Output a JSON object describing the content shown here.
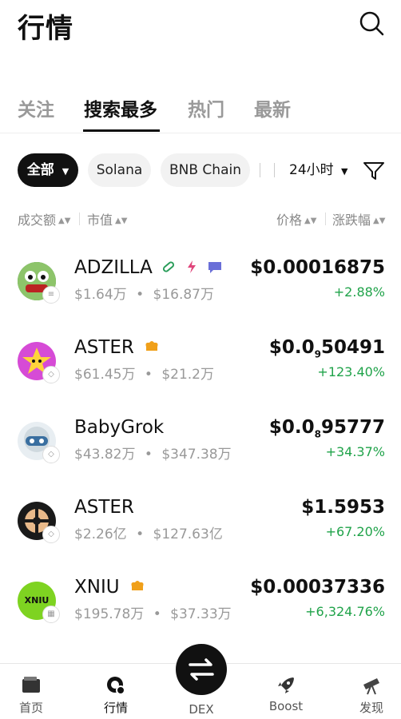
{
  "header": {
    "title": "行情"
  },
  "tabs": [
    {
      "label": "关注"
    },
    {
      "label": "搜索最多"
    },
    {
      "label": "热门"
    },
    {
      "label": "最新"
    }
  ],
  "filters": {
    "chips": [
      "全部",
      "Solana",
      "BNB Chain"
    ],
    "period": "24小时"
  },
  "sort": {
    "volume": "成交额",
    "market_cap": "市值",
    "price": "价格",
    "change": "涨跌幅"
  },
  "tokens": [
    {
      "name": "ADZILLA",
      "volume": "$1.64万",
      "mcap": "$16.87万",
      "price": "$0.00016875",
      "change": "+2.88%"
    },
    {
      "name": "ASTER",
      "volume": "$61.45万",
      "mcap": "$21.2万",
      "price_pre": "$0.0",
      "price_sub": "9",
      "price_post": "50491",
      "change": "+123.40%"
    },
    {
      "name": "BabyGrok",
      "volume": "$43.82万",
      "mcap": "$347.38万",
      "price_pre": "$0.0",
      "price_sub": "8",
      "price_post": "95777",
      "change": "+34.37%"
    },
    {
      "name": "ASTER",
      "volume": "$2.26亿",
      "mcap": "$127.63亿",
      "price": "$1.5953",
      "change": "+67.20%"
    },
    {
      "name": "XNIU",
      "volume": "$195.78万",
      "mcap": "$37.33万",
      "price": "$0.00037336",
      "change": "+6,324.76%",
      "avatar_text": "XNIU"
    }
  ],
  "separator": "•",
  "bottom_nav": [
    {
      "label": "首页"
    },
    {
      "label": "行情"
    },
    {
      "label": "DEX"
    },
    {
      "label": "Boost"
    },
    {
      "label": "发现"
    }
  ],
  "colors": {
    "up": "#20a34a",
    "accent": "#111111",
    "muted": "#999999"
  }
}
